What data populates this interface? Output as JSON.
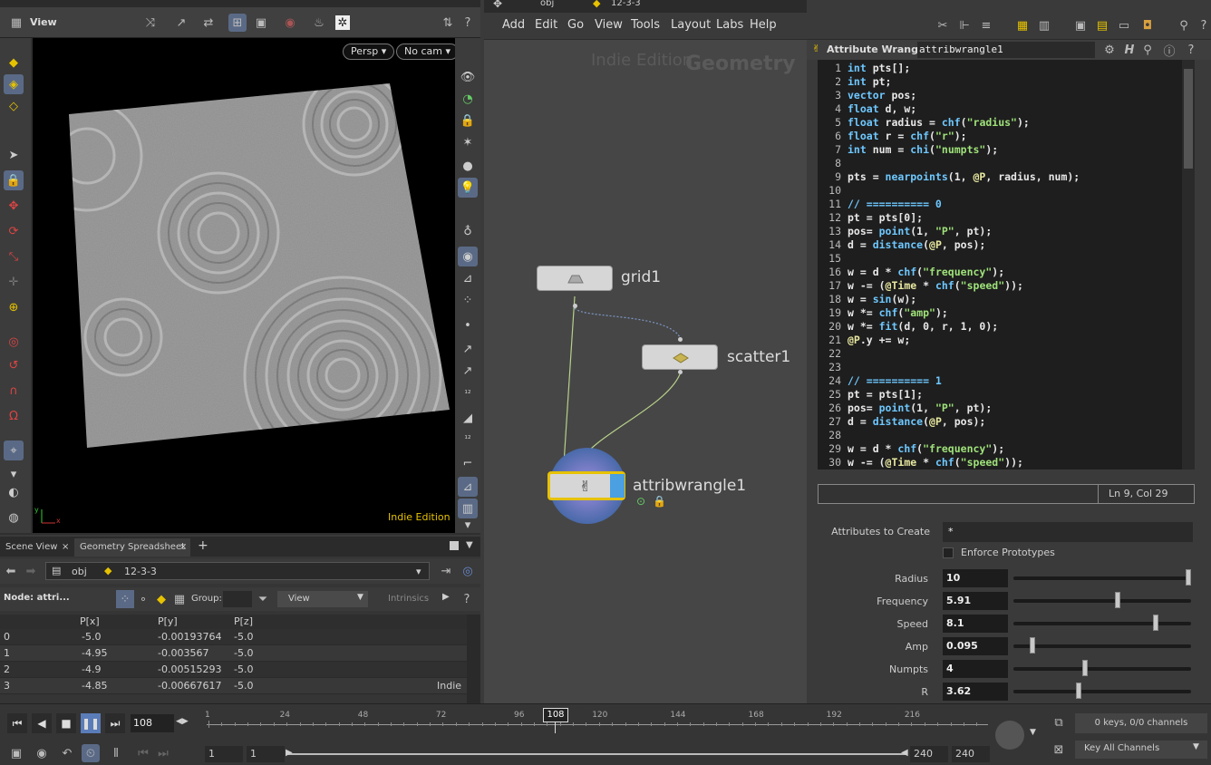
{
  "viewport": {
    "title": "View",
    "persp_label": "Persp ▾",
    "cam_label": "No cam ▾",
    "watermark": "Indie Edition",
    "axis_y": "y",
    "axis_x": "x"
  },
  "panel_tabs": {
    "scene_view": "Scene View",
    "geo_spreadsheet": "Geometry Spreadsheet",
    "close": "×",
    "add": "+"
  },
  "spreadsheet": {
    "path_obj": "obj",
    "path_geo": "12-3-3",
    "node_label": "Node: attri...",
    "group_label": "Group:",
    "view_label": "View",
    "intrinsics_label": "Intrinsics",
    "columns": [
      "",
      "P[x]",
      "P[y]",
      "P[z]"
    ],
    "rows": [
      [
        "0",
        "-5.0",
        "-0.00193764",
        "-5.0"
      ],
      [
        "1",
        "-4.95",
        "-0.003567",
        "-5.0"
      ],
      [
        "2",
        "-4.9",
        "-0.00515293",
        "-5.0"
      ],
      [
        "3",
        "-4.85",
        "-0.00667617",
        "-5.0"
      ]
    ],
    "watermark": "Indie"
  },
  "network": {
    "path_obj": "obj",
    "path_geo": "12-3-3",
    "menu": [
      "Add",
      "Edit",
      "Go",
      "View",
      "Tools",
      "Layout",
      "Labs",
      "Help"
    ],
    "watermark_indie": "Indie Edition",
    "watermark_context": "Geometry",
    "nodes": {
      "grid": "grid1",
      "scatter": "scatter1",
      "wrangle": "attribwrangle1"
    }
  },
  "wrangle": {
    "type_label": "Attribute Wrangle",
    "node_name": "attribwrangle1",
    "status": "Ln 9, Col 29",
    "code": [
      "int pts[];",
      "int pt;",
      "vector pos;",
      "float d, w;",
      "float radius = chf(\"radius\");",
      "float r = chf(\"r\");",
      "int num = chi(\"numpts\");",
      "",
      "pts = nearpoints(1, @P, radius, num);",
      "",
      "// ========== 0",
      "pt = pts[0];",
      "pos= point(1, \"P\", pt);",
      "d = distance(@P, pos);",
      "",
      "w = d * chf(\"frequency\");",
      "w -= (@Time * chf(\"speed\"));",
      "w = sin(w);",
      "w *= chf(\"amp\");",
      "w *= fit(d, 0, r, 1, 0);",
      "@P.y += w;",
      "",
      "",
      "// ========== 1",
      "pt = pts[1];",
      "pos= point(1, \"P\", pt);",
      "d = distance(@P, pos);",
      "",
      "w = d * chf(\"frequency\");",
      "w -= (@Time * chf(\"speed\"));"
    ],
    "attributes_to_create_label": "Attributes to Create",
    "attributes_to_create_value": "*",
    "enforce_prototypes_label": "Enforce Prototypes",
    "params": [
      {
        "label": "Radius",
        "value": "10",
        "fraction": 1.0
      },
      {
        "label": "Frequency",
        "value": "5.91",
        "fraction": 0.591
      },
      {
        "label": "Speed",
        "value": "8.1",
        "fraction": 0.81
      },
      {
        "label": "Amp",
        "value": "0.095",
        "fraction": 0.095
      },
      {
        "label": "Numpts",
        "value": "4",
        "fraction": 0.4
      },
      {
        "label": "R",
        "value": "3.62",
        "fraction": 0.362
      }
    ]
  },
  "timeline": {
    "current_frame": "108",
    "frame_marker": "108",
    "ticks": [
      "1",
      "24",
      "48",
      "72",
      "96",
      "120",
      "144",
      "168",
      "192",
      "216"
    ],
    "range_start": "1",
    "range_start2": "1",
    "range_end": "240",
    "range_end2": "240",
    "keys_label": "0 keys, 0/0 channels",
    "key_all_label": "Key All Channels"
  },
  "colors": {
    "accent_blue": "#5a6a86",
    "node_selected_outline": "#e6c200",
    "wire": "#b8d08a",
    "keyword": "#6ec8ff",
    "string": "#9fe27a",
    "function": "#6ec8ff",
    "comment": "#6ec8ff"
  }
}
